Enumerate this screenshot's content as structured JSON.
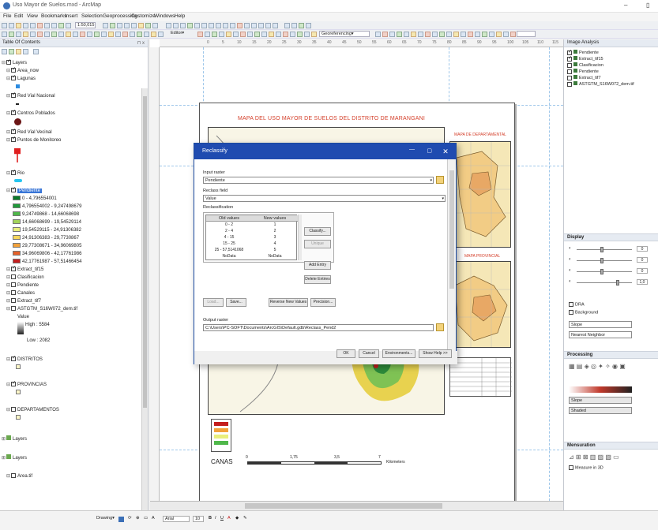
{
  "window": {
    "title": "Uso Mayor de Suelos.mxd - ArcMap"
  },
  "menu": [
    "File",
    "Edit",
    "View",
    "Bookmarks",
    "Insert",
    "Selection",
    "Geoprocessing",
    "Customize",
    "Windows",
    "Help"
  ],
  "toolbar": {
    "scale": "1:50,015",
    "editor_label": "Editor▾",
    "georef_label": "Georeferencing▾"
  },
  "toc": {
    "title": "Table Of Contents",
    "pin": "⊓ x",
    "layers": [
      {
        "label": "Layers",
        "level": 0,
        "checked": true,
        "group": true
      },
      {
        "label": "Area_now",
        "level": 1,
        "checked": true
      },
      {
        "label": "Lagunas",
        "level": 1,
        "checked": true
      },
      {
        "label": "Red Vial Nacional",
        "level": 1,
        "checked": true
      },
      {
        "label": "Centros Poblados",
        "level": 1,
        "checked": true
      },
      {
        "label": "Red Vial Vecinal",
        "level": 1,
        "checked": true
      },
      {
        "label": "Puntos de Monitoreo",
        "level": 1,
        "checked": true
      },
      {
        "label": "Rio",
        "level": 1,
        "checked": true
      },
      {
        "label": "Pendiente",
        "level": 1,
        "checked": true,
        "selected": true
      }
    ],
    "pendiente_classes": [
      {
        "label": "0 - 4,796554001",
        "color": "#0a7a2a"
      },
      {
        "label": "4,796554002 - 9,247498679",
        "color": "#1f9a3a"
      },
      {
        "label": "9,24749868 - 14,66068698",
        "color": "#4fb84a"
      },
      {
        "label": "14,66068699 - 19,54529114",
        "color": "#a3d35a"
      },
      {
        "label": "19,54529115 - 24,91306382",
        "color": "#e9ef7c"
      },
      {
        "label": "24,91306383 - 29,7730867",
        "color": "#f6d65b"
      },
      {
        "label": "29,77308671 - 34,96069805",
        "color": "#f2a13a"
      },
      {
        "label": "34,96069806 - 42,17761986",
        "color": "#e5622b"
      },
      {
        "label": "42,17761987 - 57,51466454",
        "color": "#c41e1e"
      }
    ],
    "more_layers": [
      {
        "label": "Extract_tif15",
        "level": 1,
        "checked": true
      },
      {
        "label": "Clasificacion",
        "level": 1,
        "checked": false
      },
      {
        "label": "Pendiente",
        "level": 1,
        "checked": false
      },
      {
        "label": "Canales",
        "level": 1,
        "checked": false
      },
      {
        "label": "Extract_tif7",
        "level": 1,
        "checked": false
      },
      {
        "label": "ASTGTM_S16W072_dem.tif",
        "level": 1,
        "checked": false
      }
    ],
    "dem_value_label": "Value",
    "dem_high": "High : 5584",
    "dem_low": "Low : 2082",
    "lower_layers": [
      {
        "label": "DISTRITOS",
        "checked": true
      },
      {
        "label": "PROVINCIAS",
        "checked": true
      },
      {
        "label": "DEPARTAMENTOS",
        "checked": false
      }
    ],
    "bottom_groups": [
      "Layers",
      "Layers"
    ],
    "last_item": "Area.tif"
  },
  "layout": {
    "ruler_ticks": [
      "0",
      "5",
      "10",
      "15",
      "20",
      "25",
      "30",
      "35",
      "40",
      "45",
      "50",
      "55",
      "60",
      "65",
      "70",
      "75",
      "80",
      "85",
      "90",
      "95",
      "100",
      "105",
      "110",
      "115"
    ],
    "map_title": "MAPA DEL USO MAYOR DE SUELOS DEL DISTRITO DE MARANGANI",
    "inset1_title": "MAPA DE DEPARTAMENTAL",
    "inset2_title": "MAPA PROVINCIAL",
    "north": "N",
    "scale_label": "Kilometers",
    "scale_ticks": [
      "0",
      "1,75",
      "3,5",
      "7"
    ],
    "legend_prefix": "CANAS"
  },
  "dialog": {
    "title": "Reclassify",
    "input_raster_label": "Input raster",
    "input_raster_value": "Pendiente",
    "reclass_field_label": "Reclass field",
    "reclass_field_value": "Value",
    "reclassification_label": "Reclassification",
    "col_old": "Old values",
    "col_new": "New values",
    "rows": [
      {
        "old": "0 - 2",
        "new": "1"
      },
      {
        "old": "2 - 4",
        "new": "2"
      },
      {
        "old": "4 - 15",
        "new": "3"
      },
      {
        "old": "15 - 25",
        "new": "4"
      },
      {
        "old": "25 - 57,5141068",
        "new": "5"
      },
      {
        "old": "NoData",
        "new": "NoData"
      }
    ],
    "classify_btn": "Classify...",
    "unique_btn": "Unique",
    "add_entry_btn": "Add Entry",
    "delete_entries_btn": "Delete Entries",
    "load_btn": "Load...",
    "save_btn": "Save...",
    "reverse_btn": "Reverse New Values",
    "precision_btn": "Precision...",
    "output_label": "Output raster",
    "output_value": "C:\\Users\\PC-SOFT\\Documents\\ArcGIS\\Default.gdb\\Reclass_Pend2",
    "ok_btn": "OK",
    "cancel_btn": "Cancel",
    "env_btn": "Environments...",
    "help_btn": "Show Help >>"
  },
  "image_analysis": {
    "title": "Image Analysis",
    "layers": [
      {
        "label": "Pendiente",
        "checked": true
      },
      {
        "label": "Extract_tif15",
        "checked": true
      },
      {
        "label": "Clasificacion",
        "checked": false
      },
      {
        "label": "Pendiente",
        "checked": false
      },
      {
        "label": "Extract_tif7",
        "checked": false
      },
      {
        "label": "ASTGTM_S16W072_dem.tif",
        "checked": false
      }
    ],
    "display_title": "Display",
    "slider_values": [
      "0",
      "0",
      "0",
      "1,0"
    ],
    "dra_label": "DRA",
    "background_label": "Background",
    "fields": [
      "Slope",
      "Nearest Neighbor"
    ],
    "processing_title": "Processing",
    "proc_field1": "Slope",
    "proc_field2": "Shaded",
    "mensuration_title": "Mensuration",
    "measure_label": "Measure in 3D"
  },
  "status": {
    "drawing_label": "Drawing▾",
    "font_name": "Arial",
    "font_size": "10"
  },
  "colors": {
    "accent": "#1f4bb0",
    "title_red": "#d43f2a"
  }
}
